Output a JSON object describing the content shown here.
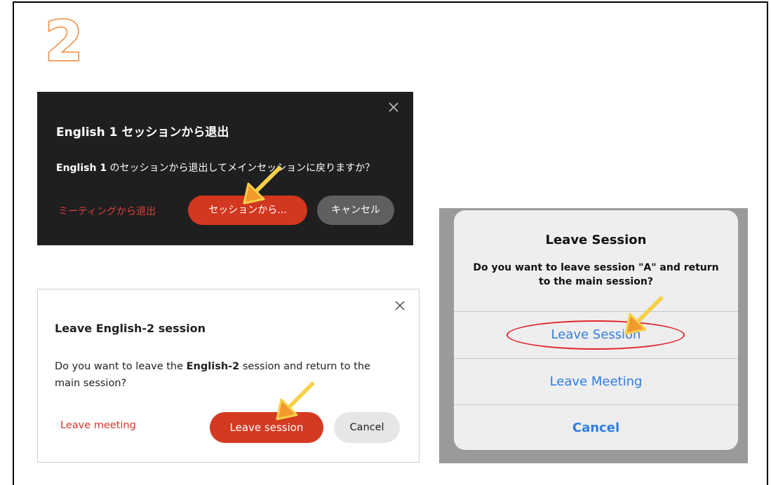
{
  "step_number": "2",
  "colors": {
    "accent_orange": "#f08a3a",
    "zoom_red": "#d2371f",
    "ios_blue": "#2f7de1",
    "highlight_red": "#e0262a"
  },
  "dark_dialog": {
    "title": "English 1 セッションから退出",
    "message_bold": "English 1",
    "message_rest": " のセッションから退出してメインセッションに戻りますか？",
    "leave_meeting_label": "ミーティングから退出",
    "primary_label": "セッションから...",
    "cancel_label": "キャンセル",
    "close_icon": "close-icon"
  },
  "light_dialog": {
    "title": "Leave English-2 session",
    "message_prefix": "Do you want to leave the ",
    "message_bold": "English-2",
    "message_suffix": " session and return to the main session?",
    "leave_meeting_label": "Leave meeting",
    "primary_label": "Leave session",
    "cancel_label": "Cancel",
    "close_icon": "close-icon"
  },
  "ios_sheet": {
    "title": "Leave Session",
    "message": "Do you want to leave session \"A\" and return to the main session?",
    "leave_session_label": "Leave Session",
    "leave_meeting_label": "Leave Meeting",
    "cancel_label": "Cancel"
  }
}
